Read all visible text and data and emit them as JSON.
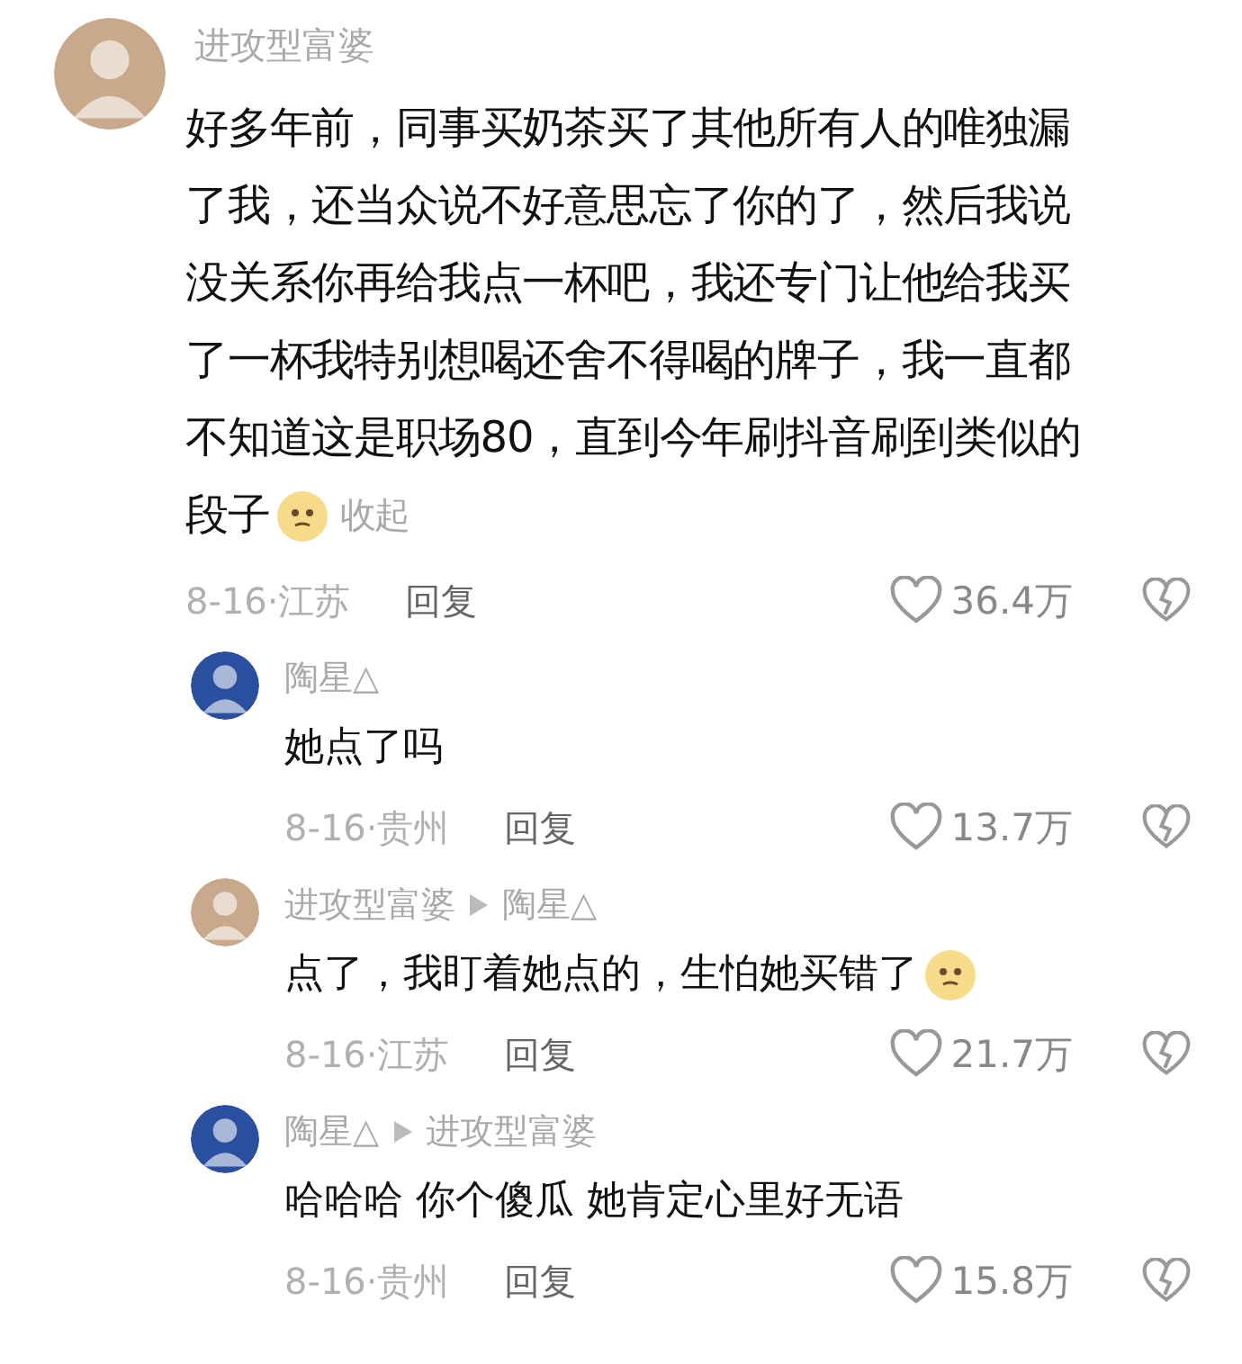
{
  "comment": {
    "author": "进攻型富婆",
    "color": "#c9a98c",
    "lines": [
      "好多年前，同事买奶茶买了其他所有人的唯独漏",
      "了我，还当众说不好意思忘了你的了，然后我说",
      "没关系你再给我点一杯吧，我还专门让他给我买",
      "了一杯我特别想喝还舍不得喝的牌子，我一直都",
      "不知道这是职场80，直到今年刷抖音刷到类似的",
      "段子"
    ],
    "emoji": true,
    "collapse": "收起",
    "meta": "8-16·江苏",
    "reply": "回复",
    "likes": "36.4万"
  },
  "replies": [
    {
      "author": "陶星△",
      "color": "#2a4f9e",
      "text": "她点了吗",
      "emoji": false,
      "meta": "8-16·贵州",
      "reply": "回复",
      "likes": "13.7万"
    },
    {
      "author": "进攻型富婆",
      "reply_to": "陶星△",
      "color": "#c9a98c",
      "text": "点了，我盯着她点的，生怕她买错了",
      "emoji": true,
      "meta": "8-16·江苏",
      "reply": "回复",
      "likes": "21.7万"
    },
    {
      "author": "陶星△",
      "reply_to": "进攻型富婆",
      "color": "#2a4f9e",
      "text": "哈哈哈 你个傻瓜 她肯定心里好无语",
      "emoji": false,
      "meta": "8-16·贵州",
      "reply": "回复",
      "likes": "15.8万"
    }
  ]
}
